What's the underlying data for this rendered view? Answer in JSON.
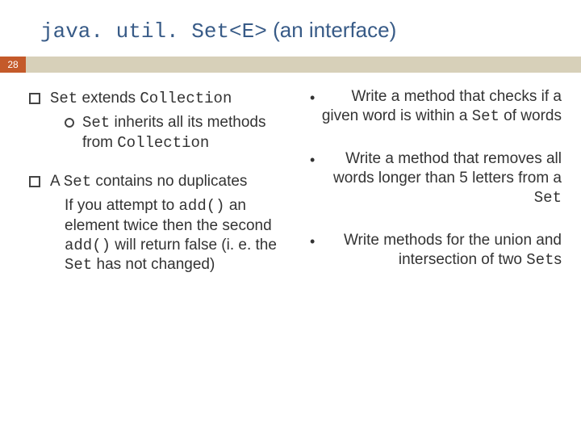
{
  "title": {
    "code": "java. util. Set<E>",
    "rest": " (an interface)"
  },
  "page_number": "28",
  "left": {
    "item1": {
      "line": {
        "pre": "",
        "code1": "Set",
        "mid": " extends ",
        "code2": "Collection"
      },
      "sub": {
        "pre": "",
        "code1": "Set",
        "mid": " inherits all its methods from ",
        "code2": "Collection"
      }
    },
    "item2": {
      "line": {
        "pre": "A ",
        "code1": "Set",
        "mid": " contains no duplicates"
      },
      "sub": {
        "pre": "If you attempt to ",
        "code1": "add()",
        "mid": " an element twice then the second ",
        "code2": "add()",
        "tail1": " will return false (i. e. the ",
        "code3": "Set",
        "tail2": " has not changed)"
      }
    }
  },
  "right": {
    "r1": {
      "pre": "Write a method that checks if a given word is within a ",
      "code": "Set",
      "post": " of words"
    },
    "r2": {
      "pre": "Write a method that removes all words longer than 5 letters from a ",
      "code": "Set",
      "post": ""
    },
    "r3": {
      "pre": "Write methods for the union and intersection of two ",
      "code": "Set",
      "post": "s"
    }
  }
}
